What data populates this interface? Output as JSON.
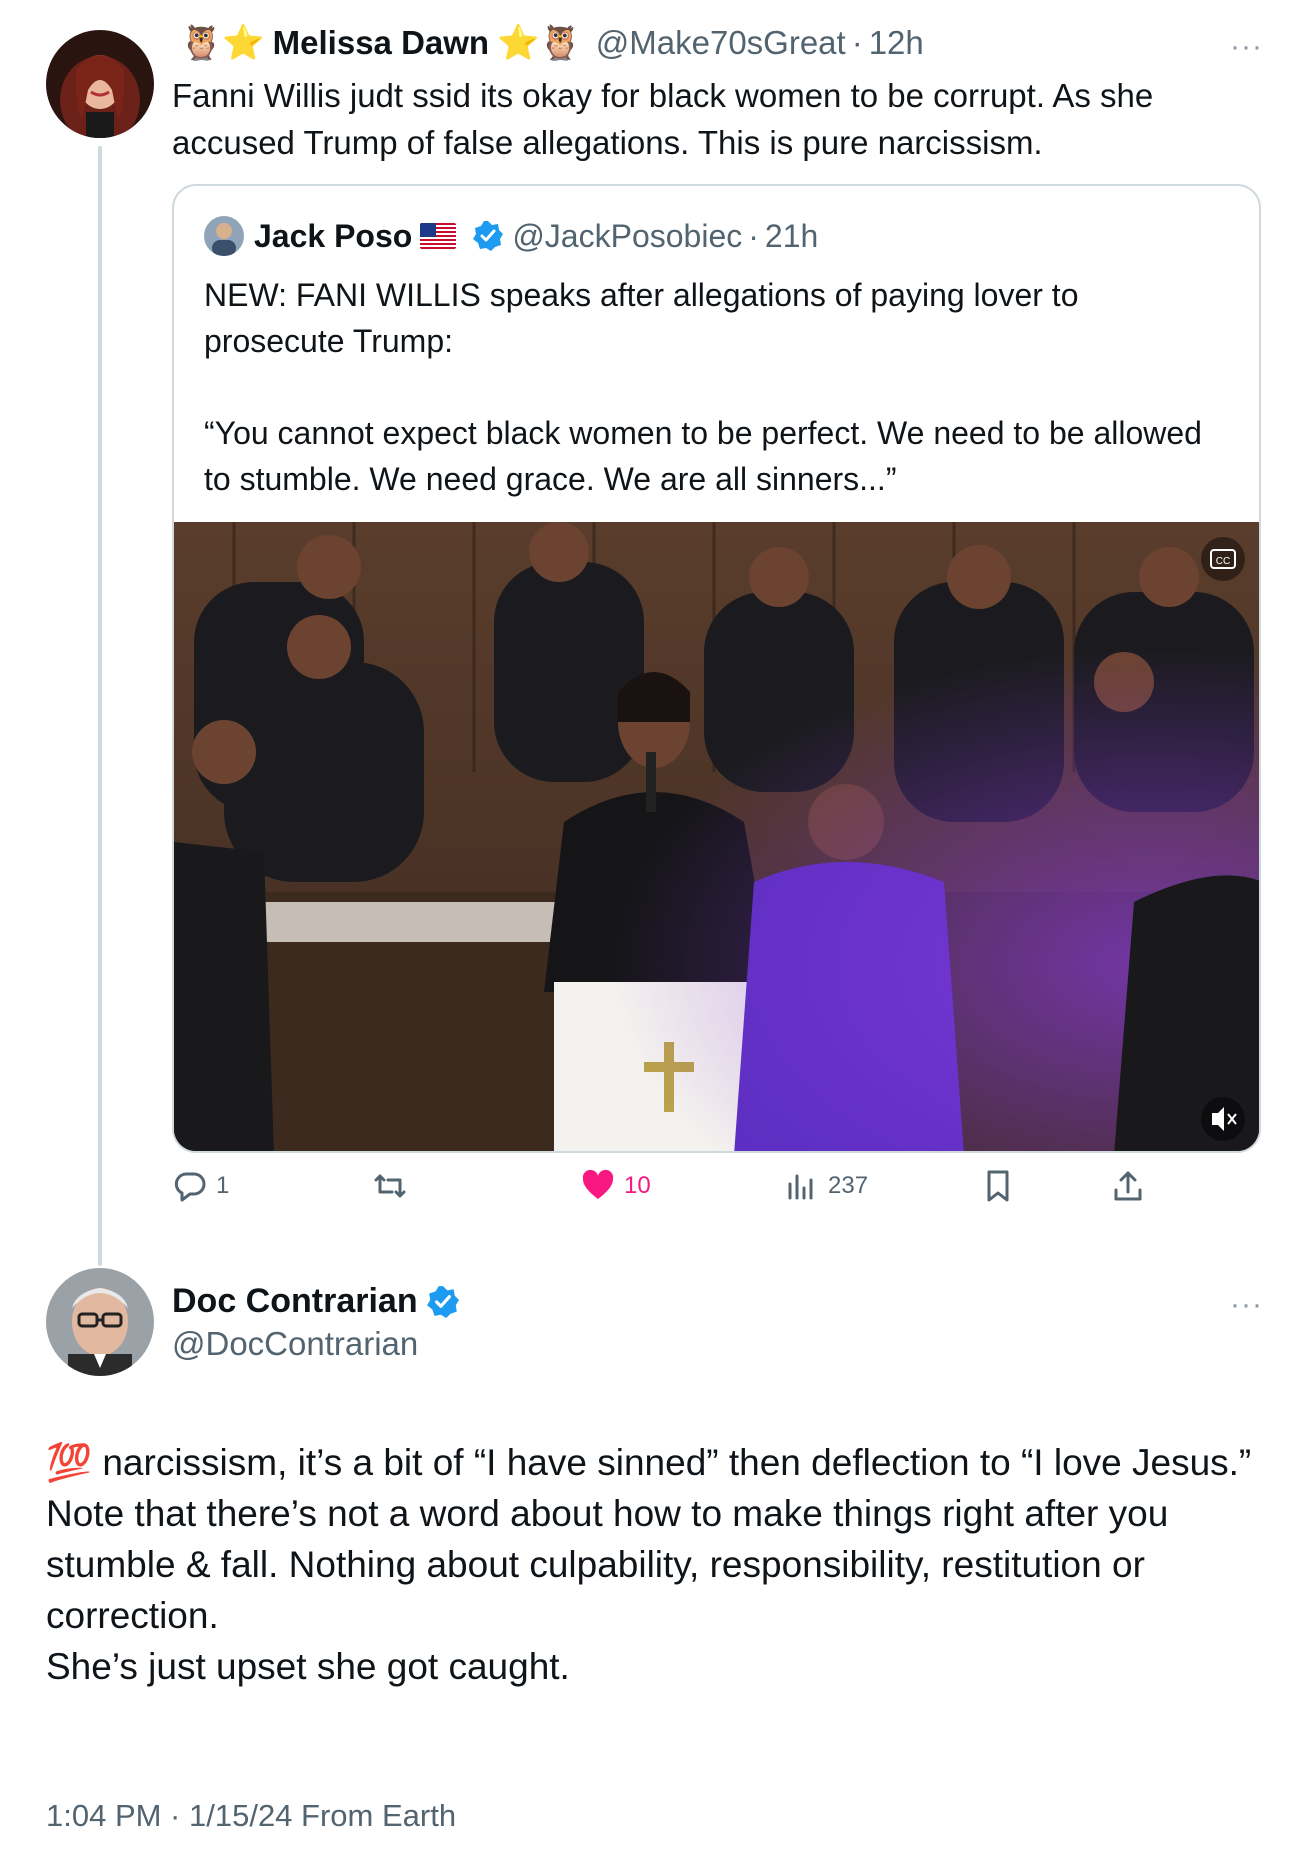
{
  "original_tweet": {
    "author_name": "Melissa Dawn",
    "name_decor_left": "🦉⭐",
    "name_decor_right": "⭐🦉",
    "handle": "@Make70sGreat",
    "time": "12h",
    "text": "Fanni Willis judt ssid its okay for black women to be corrupt. As she accused Trump of false allegations. This is pure narcissism.",
    "more_label": "···"
  },
  "quoted_tweet": {
    "author_name": "Jack Poso",
    "handle": "@JackPosobiec",
    "time": "21h",
    "text_line1": "NEW: FANI WILLIS speaks after allegations of paying lover to prosecute Trump:",
    "text_line2": "“You cannot expect black women to be perfect. We need to be allowed to stumble. We need grace. We are all sinners...”",
    "media": "video",
    "verified": true
  },
  "actions": {
    "replies": "1",
    "likes": "10",
    "views": "237"
  },
  "reply": {
    "author_name": "Doc Contrarian",
    "handle": "@DocContrarian",
    "verified": true,
    "emoji": "💯",
    "line1": "narcissism, it’s a bit of “I have sinned” then deflection to “I love Jesus.”",
    "line2": "Note that there’s not a word about how to make things right after you stumble & fall. Nothing about culpability, responsibility, restitution or correction.",
    "line3": "She’s just upset she got caught.",
    "more_label": "···",
    "footer": "1:04 PM · 1/15/24 From Earth"
  },
  "colors": {
    "text": "#0f1419",
    "secondary": "#536471",
    "border": "#cfd9de",
    "verified": "#1d9bf0",
    "like": "#f91880"
  },
  "icons": [
    "reply-icon",
    "retweet-icon",
    "heart-icon",
    "views-icon",
    "bookmark-icon",
    "share-icon",
    "captions-icon",
    "mute-icon",
    "verified-badge-icon"
  ]
}
